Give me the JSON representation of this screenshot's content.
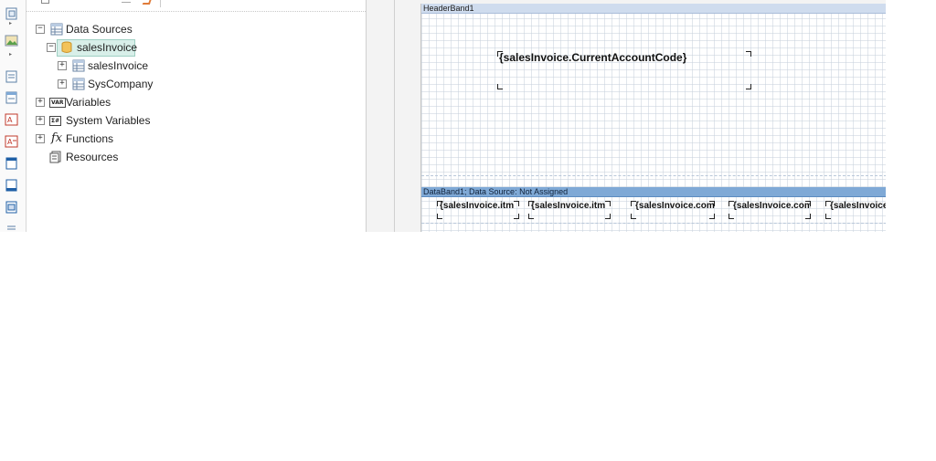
{
  "dictionary": {
    "tree": [
      {
        "label": "Data Sources",
        "expander": "−",
        "icon": "table-icon"
      },
      {
        "label": "salesInvoice",
        "expander": "−",
        "icon": "database-icon",
        "selected": true
      },
      {
        "label": "salesInvoice",
        "expander": "+",
        "icon": "table-icon"
      },
      {
        "label": "SysCompany",
        "expander": "+",
        "icon": "table-icon"
      },
      {
        "label": "Variables",
        "expander": "+",
        "icon": "variables-icon",
        "icon_text": "VAR"
      },
      {
        "label": "System Variables",
        "expander": "+",
        "icon": "system-variables-icon",
        "icon_text": "Σ#"
      },
      {
        "label": "Functions",
        "expander": "+",
        "icon": "function-icon",
        "icon_text": "fx"
      },
      {
        "label": "Resources",
        "expander": "",
        "icon": "resources-icon"
      }
    ]
  },
  "designer": {
    "header_band": {
      "title": "HeaderBand1",
      "textbox": "{salesInvoice.CurrentAccountCode}"
    },
    "data_band": {
      "title": "DataBand1; Data Source: Not Assigned",
      "cells": [
        "{salesInvoice.itm",
        "{salesInvoice.itm",
        "{salesInvoice.com",
        "{salesInvoice.com",
        "{salesInvoice"
      ]
    }
  },
  "colors": {
    "header_band": "#cfdcee",
    "data_band": "#7fa9d6",
    "selection": "#d8efe9"
  }
}
